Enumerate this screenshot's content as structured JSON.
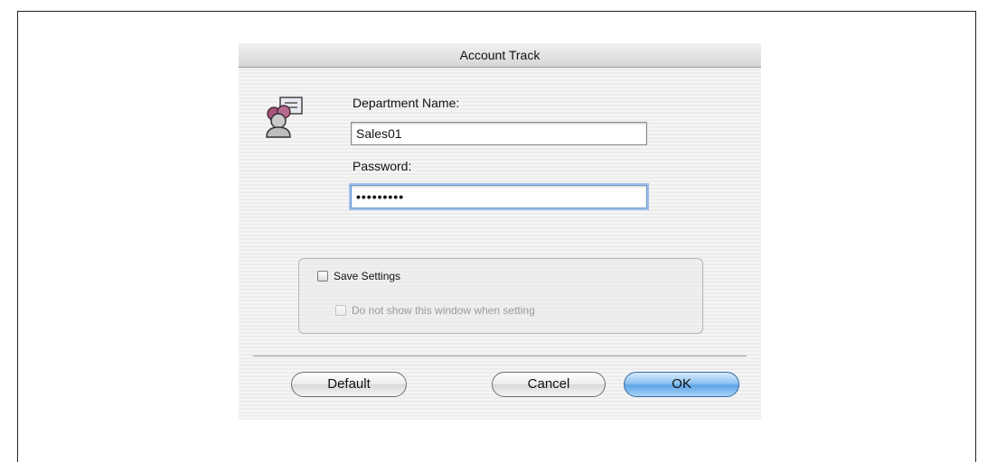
{
  "window": {
    "title": "Account Track"
  },
  "form": {
    "department_label": "Department Name:",
    "department_value": "Sales01",
    "password_label": "Password:",
    "password_value": "•••••••••"
  },
  "options": {
    "save_settings_label": "Save Settings",
    "save_settings_checked": false,
    "no_show_label": "Do not show this window when setting",
    "no_show_checked": false,
    "no_show_enabled": false
  },
  "buttons": {
    "default_label": "Default",
    "cancel_label": "Cancel",
    "ok_label": "OK"
  },
  "icons": {
    "app": "account-track-icon"
  },
  "colors": {
    "focus_ring": "#9ec0ea",
    "ok_button": "#5ea4e6",
    "title_text": "#111111"
  }
}
